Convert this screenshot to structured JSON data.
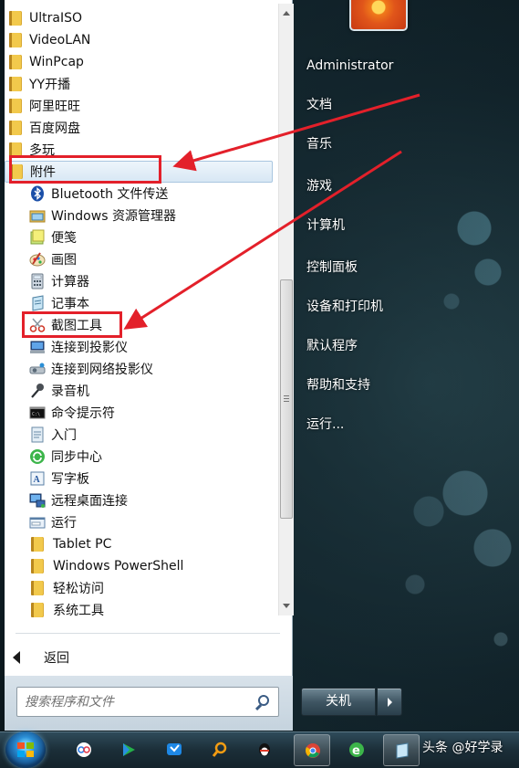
{
  "user": {
    "name": "Administrator"
  },
  "right_menu": [
    {
      "label": "文档"
    },
    {
      "label": "音乐"
    },
    {
      "label": "游戏"
    },
    {
      "label": "计算机"
    },
    {
      "label": "控制面板"
    },
    {
      "label": "设备和打印机"
    },
    {
      "label": "默认程序"
    },
    {
      "label": "帮助和支持"
    },
    {
      "label": "运行..."
    }
  ],
  "programs": {
    "top_folders": [
      {
        "label": "UltraISO"
      },
      {
        "label": "VideoLAN"
      },
      {
        "label": "WinPcap"
      },
      {
        "label": "YY开播"
      },
      {
        "label": "阿里旺旺"
      },
      {
        "label": "百度网盘"
      },
      {
        "label": "多玩"
      },
      {
        "label": "附件"
      }
    ],
    "accessories": [
      {
        "label": "Bluetooth 文件传送",
        "icon": "bluetooth-icon"
      },
      {
        "label": "Windows 资源管理器",
        "icon": "explorer-icon"
      },
      {
        "label": "便笺",
        "icon": "sticky-notes-icon"
      },
      {
        "label": "画图",
        "icon": "paint-icon"
      },
      {
        "label": "计算器",
        "icon": "calculator-icon"
      },
      {
        "label": "记事本",
        "icon": "notepad-icon"
      },
      {
        "label": "截图工具",
        "icon": "scissors-icon"
      },
      {
        "label": "连接到投影仪",
        "icon": "projector-icon"
      },
      {
        "label": "连接到网络投影仪",
        "icon": "network-projector-icon"
      },
      {
        "label": "录音机",
        "icon": "microphone-icon"
      },
      {
        "label": "命令提示符",
        "icon": "cmd-icon"
      },
      {
        "label": "入门",
        "icon": "getting-started-icon"
      },
      {
        "label": "同步中心",
        "icon": "sync-icon"
      },
      {
        "label": "写字板",
        "icon": "wordpad-icon"
      },
      {
        "label": "远程桌面连接",
        "icon": "remote-desktop-icon"
      },
      {
        "label": "运行",
        "icon": "run-icon"
      }
    ],
    "sub_folders": [
      {
        "label": "Tablet PC"
      },
      {
        "label": "Windows PowerShell"
      },
      {
        "label": "轻松访问"
      },
      {
        "label": "系统工具"
      }
    ]
  },
  "back_label": "返回",
  "search": {
    "placeholder": "搜索程序和文件"
  },
  "shutdown": {
    "label": "关机"
  },
  "watermark": "头条 @好学录",
  "colors": {
    "annotation_red": "#e3202a",
    "selected_bg": "#d8e7f4",
    "folder": "#f2c94c"
  }
}
